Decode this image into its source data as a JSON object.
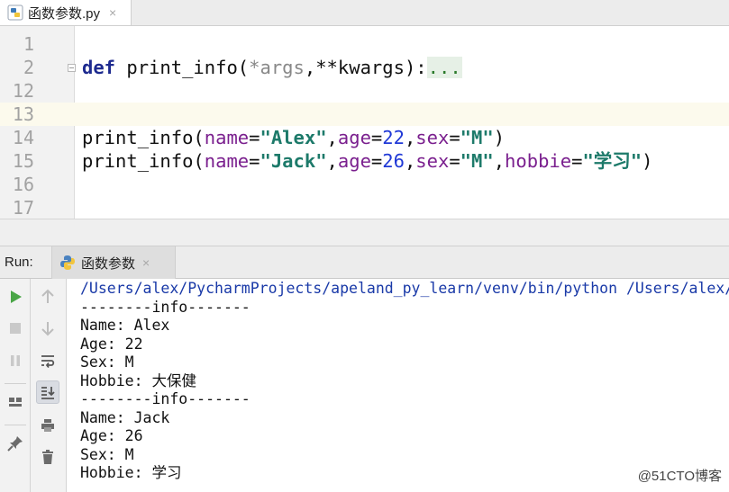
{
  "editor_tab": {
    "filename": "函数参数.py",
    "close": "×"
  },
  "editor": {
    "line_numbers": [
      "1",
      "2",
      "12",
      "13",
      "14",
      "15",
      "16",
      "17"
    ],
    "line2": {
      "def": "def",
      "name": " print_info(",
      "star1": "*",
      "args": "args",
      "comma": ",",
      "star2": "**",
      "kwargs": "kwargs",
      "close": "):",
      "folded": "..."
    },
    "line14": {
      "fn": "print_info(",
      "p1": "name",
      "eq1": "=",
      "v1": "\"Alex\"",
      "c1": ",",
      "p2": "age",
      "eq2": "=",
      "v2": "22",
      "c2": ",",
      "p3": "sex",
      "eq3": "=",
      "v3": "\"M\"",
      "close": ")"
    },
    "line15": {
      "fn": "print_info(",
      "p1": "name",
      "eq1": "=",
      "v1": "\"Jack\"",
      "c1": ",",
      "p2": "age",
      "eq2": "=",
      "v2": "26",
      "c2": ",",
      "p3": "sex",
      "eq3": "=",
      "v3": "\"M\"",
      "c3": ",",
      "p4": "hobbie",
      "eq4": "=",
      "v4": "\"学习\"",
      "close": ")"
    }
  },
  "run": {
    "label": "Run:",
    "tab_label": "函数参数",
    "close": "×",
    "toolbar_icons": [
      "play-icon",
      "stop-icon",
      "pause-icon",
      "layout-icon",
      "pin-icon",
      "up-arrow-icon",
      "down-arrow-icon",
      "soft-wrap-icon",
      "scroll-to-end-icon",
      "print-icon",
      "trash-icon"
    ]
  },
  "console": [
    "/Users/alex/PycharmProjects/apeland_py_learn/venv/bin/python /Users/alex/Py",
    "--------info-------",
    "Name: Alex",
    "Age: 22",
    "Sex: M",
    "Hobbie: 大保健",
    "--------info-------",
    "Name: Jack",
    "Age: 26",
    "Sex: M",
    "Hobbie: 学习"
  ],
  "watermark": "@51CTO博客"
}
